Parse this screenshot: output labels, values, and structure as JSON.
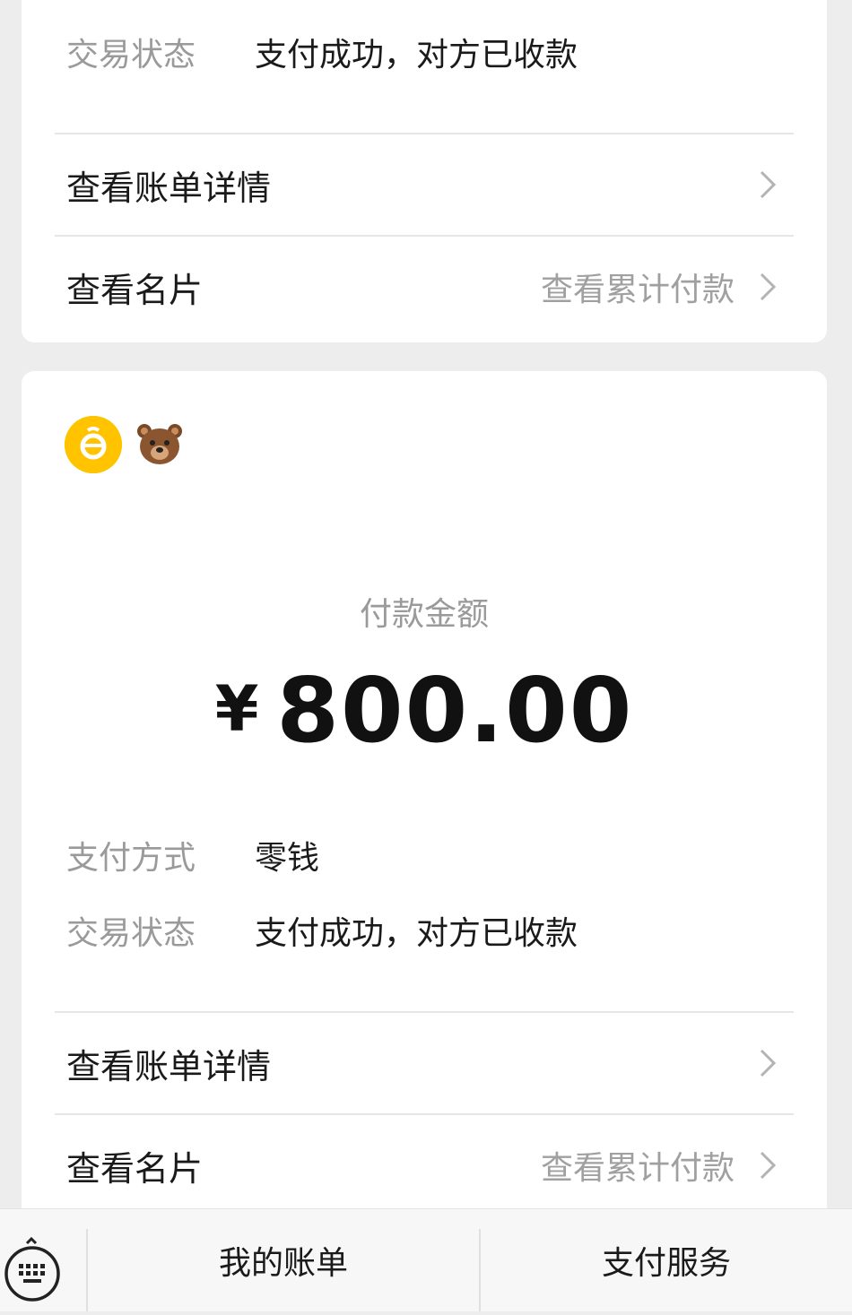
{
  "card1": {
    "status_label": "交易状态",
    "status_value": "支付成功，对方已收款",
    "bill_details": "查看账单详情",
    "business_card": "查看名片",
    "cumulative": "查看累计付款"
  },
  "card2": {
    "app_icon": "app-logo-icon",
    "user_avatar": "bear-emoji-icon",
    "amount_label": "付款金额",
    "currency": "¥",
    "amount": "800.00",
    "method_label": "支付方式",
    "method_value": "零钱",
    "status_label": "交易状态",
    "status_value": "支付成功，对方已收款",
    "bill_details": "查看账单详情",
    "business_card": "查看名片",
    "cumulative": "查看累计付款"
  },
  "bottom_bar": {
    "keyboard_icon": "keyboard-icon",
    "tab_bill": "我的账单",
    "tab_payment": "支付服务"
  },
  "colors": {
    "accent": "#ffc300",
    "label_gray": "#9a9a9a",
    "text": "#1a1a1a"
  }
}
